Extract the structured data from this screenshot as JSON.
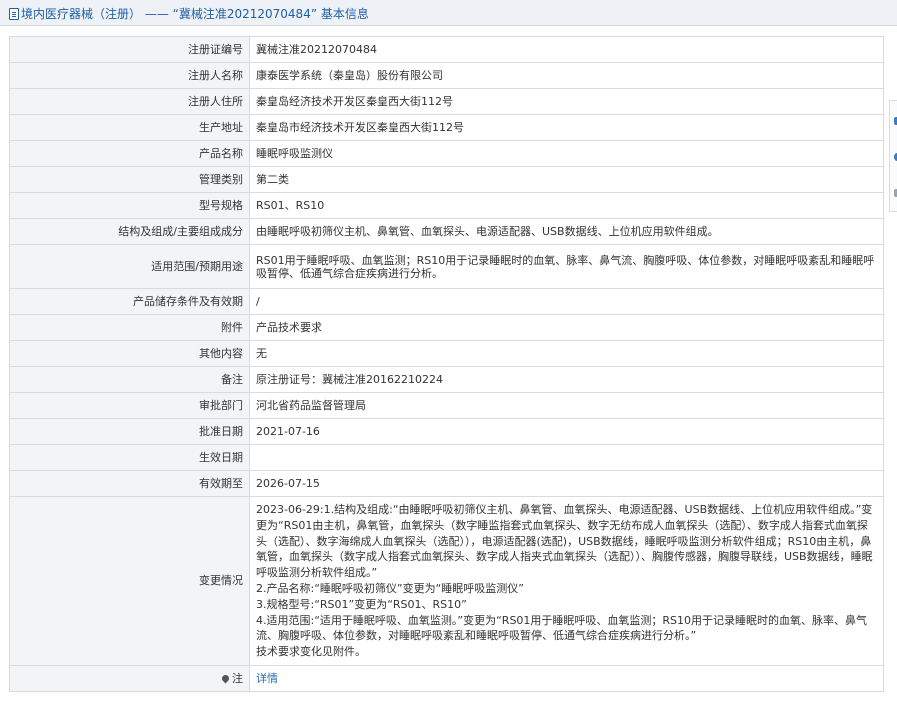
{
  "header": {
    "breadcrumb": "境内医疗器械（注册） —— “冀械注准20212070484” 基本信息"
  },
  "rows": [
    {
      "label": "注册证编号",
      "value": "冀械注准20212070484"
    },
    {
      "label": "注册人名称",
      "value": "康泰医学系统（秦皇岛）股份有限公司"
    },
    {
      "label": "注册人住所",
      "value": "秦皇岛经济技术开发区秦皇西大街112号"
    },
    {
      "label": "生产地址",
      "value": "秦皇岛市经济技术开发区秦皇西大街112号"
    },
    {
      "label": "产品名称",
      "value": "睡眠呼吸监测仪"
    },
    {
      "label": "管理类别",
      "value": "第二类"
    },
    {
      "label": "型号规格",
      "value": "RS01、RS10"
    },
    {
      "label": "结构及组成/主要组成成分",
      "value": "由睡眠呼吸初筛仪主机、鼻氧管、血氧探头、电源适配器、USB数据线、上位机应用软件组成。"
    },
    {
      "label": "适用范围/预期用途",
      "value": "RS01用于睡眠呼吸、血氧监测；RS10用于记录睡眠时的血氧、脉率、鼻气流、胸腹呼吸、体位参数，对睡眠呼吸紊乱和睡眠呼吸暂停、低通气综合症疾病进行分析。"
    },
    {
      "label": "产品储存条件及有效期",
      "value": "/"
    },
    {
      "label": "附件",
      "value": "产品技术要求"
    },
    {
      "label": "其他内容",
      "value": "无"
    },
    {
      "label": "备注",
      "value": "原注册证号：冀械注准20162210224"
    },
    {
      "label": "审批部门",
      "value": "河北省药品监督管理局"
    },
    {
      "label": "批准日期",
      "value": "2021-07-16"
    },
    {
      "label": "生效日期",
      "value": ""
    },
    {
      "label": "有效期至",
      "value": "2026-07-15"
    }
  ],
  "change": {
    "label": "变更情况",
    "lines": [
      "2023-06-29:1.结构及组成:“由睡眠呼吸初筛仪主机、鼻氧管、血氧探头、电源适配器、USB数据线、上位机应用软件组成。”变更为“RS01由主机，鼻氧管，血氧探头（数字睡监指套式血氧探头、数字无纺布成人血氧探头（选配）、数字成人指套式血氧探头（选配）、数字海绵成人血氧探头（选配）），电源适配器(选配)，USB数据线，睡眠呼吸监测分析软件组成；RS10由主机，鼻氧管，血氧探头（数字成人指套式血氧探头、数字成人指夹式血氧探头（选配））、胸腹传感器，胸腹导联线，USB数据线，睡眠呼吸监测分析软件组成。”",
      "2.产品名称:“睡眠呼吸初筛仪”变更为“睡眠呼吸监测仪”",
      "3.规格型号:“RS01”变更为“RS01、RS10”",
      "4.适用范围:“适用于睡眠呼吸、血氧监测。”变更为“RS01用于睡眠呼吸、血氧监测；RS10用于记录睡眠时的血氧、脉率、鼻气流、胸腹呼吸、体位参数，对睡眠呼吸紊乱和睡眠呼吸暂停、低通气综合症疾病进行分析。”",
      "技术要求变化见附件。"
    ]
  },
  "note": {
    "label": "注",
    "link": "详情"
  }
}
